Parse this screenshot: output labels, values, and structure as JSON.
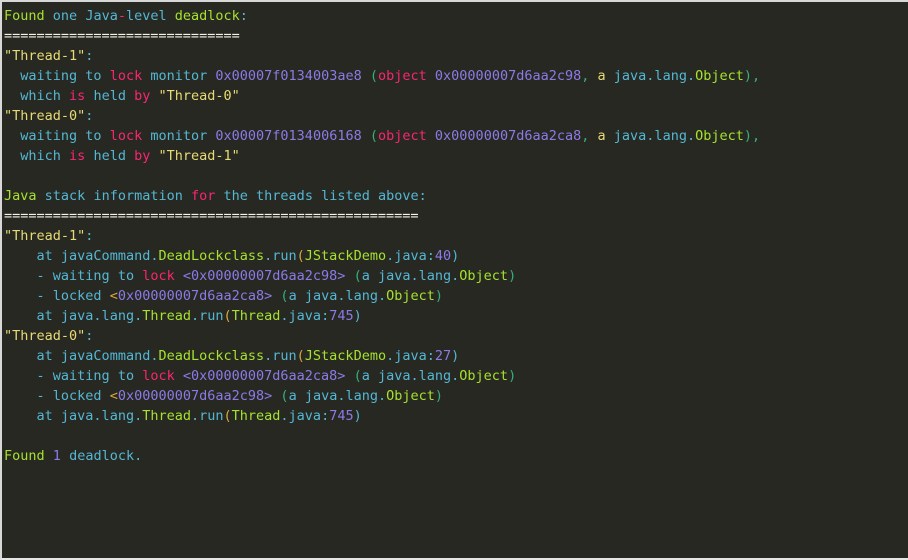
{
  "window": {
    "title": "jstack deadlock output",
    "background_color": "#272822",
    "border_color": "#d8d8d8"
  },
  "palette": {
    "green": "#a6e22e",
    "cyan": "#54b7d4",
    "red": "#f92672",
    "purple": "#8d7ae6",
    "yellow": "#e6db74",
    "white": "#f6f2e7",
    "orange": "#d8a93c",
    "teal": "#35b07b"
  },
  "console": {
    "lines": [
      {
        "id": "line-found-one-deadlock",
        "tokens": [
          {
            "t": "Found",
            "c": "c-green"
          },
          {
            "t": " ",
            "c": "c-cyan"
          },
          {
            "t": "one",
            "c": "c-cyan"
          },
          {
            "t": " ",
            "c": "c-cyan"
          },
          {
            "t": "Java",
            "c": "c-cyan"
          },
          {
            "t": "-",
            "c": "c-red"
          },
          {
            "t": "level",
            "c": "c-cyan"
          },
          {
            "t": " ",
            "c": "c-cyan"
          },
          {
            "t": "deadlock",
            "c": "c-green"
          },
          {
            "t": ":",
            "c": "c-cyan"
          }
        ]
      },
      {
        "id": "line-separator-1",
        "tokens": [
          {
            "t": "=============================",
            "c": "c-white"
          }
        ]
      },
      {
        "id": "line-thread-1-header",
        "tokens": [
          {
            "t": "\"Thread-1\"",
            "c": "c-yellow"
          },
          {
            "t": ":",
            "c": "c-cyan"
          }
        ]
      },
      {
        "id": "line-thread-1-waiting-monitor",
        "tokens": [
          {
            "t": "  waiting",
            "c": "c-cyan"
          },
          {
            "t": " ",
            "c": "c-cyan"
          },
          {
            "t": "to",
            "c": "c-cyan"
          },
          {
            "t": " ",
            "c": "c-cyan"
          },
          {
            "t": "lock",
            "c": "c-red"
          },
          {
            "t": " ",
            "c": "c-cyan"
          },
          {
            "t": "monitor",
            "c": "c-cyan"
          },
          {
            "t": " ",
            "c": "c-cyan"
          },
          {
            "t": "0x00007f0134003ae8",
            "c": "c-purple"
          },
          {
            "t": " ",
            "c": "c-cyan"
          },
          {
            "t": "(",
            "c": "c-teal"
          },
          {
            "t": "object",
            "c": "c-red"
          },
          {
            "t": " ",
            "c": "c-cyan"
          },
          {
            "t": "0x00000007d6aa2c98",
            "c": "c-purple"
          },
          {
            "t": ",",
            "c": "c-teal"
          },
          {
            "t": " ",
            "c": "c-cyan"
          },
          {
            "t": "a",
            "c": "c-yellow"
          },
          {
            "t": " ",
            "c": "c-cyan"
          },
          {
            "t": "java.lang.",
            "c": "c-cyan"
          },
          {
            "t": "Object",
            "c": "c-green"
          },
          {
            "t": ")",
            "c": "c-teal"
          },
          {
            "t": ",",
            "c": "c-teal"
          }
        ]
      },
      {
        "id": "line-thread-1-which-held-by",
        "tokens": [
          {
            "t": "  which",
            "c": "c-cyan"
          },
          {
            "t": " ",
            "c": "c-cyan"
          },
          {
            "t": "is",
            "c": "c-red"
          },
          {
            "t": " ",
            "c": "c-cyan"
          },
          {
            "t": "held",
            "c": "c-cyan"
          },
          {
            "t": " ",
            "c": "c-cyan"
          },
          {
            "t": "by",
            "c": "c-red"
          },
          {
            "t": " ",
            "c": "c-cyan"
          },
          {
            "t": "\"Thread-0\"",
            "c": "c-yellow"
          }
        ]
      },
      {
        "id": "line-thread-0-header",
        "tokens": [
          {
            "t": "\"Thread-0\"",
            "c": "c-yellow"
          },
          {
            "t": ":",
            "c": "c-cyan"
          }
        ]
      },
      {
        "id": "line-thread-0-waiting-monitor",
        "tokens": [
          {
            "t": "  waiting",
            "c": "c-cyan"
          },
          {
            "t": " ",
            "c": "c-cyan"
          },
          {
            "t": "to",
            "c": "c-cyan"
          },
          {
            "t": " ",
            "c": "c-cyan"
          },
          {
            "t": "lock",
            "c": "c-red"
          },
          {
            "t": " ",
            "c": "c-cyan"
          },
          {
            "t": "monitor",
            "c": "c-cyan"
          },
          {
            "t": " ",
            "c": "c-cyan"
          },
          {
            "t": "0x00007f0134006168",
            "c": "c-purple"
          },
          {
            "t": " ",
            "c": "c-cyan"
          },
          {
            "t": "(",
            "c": "c-teal"
          },
          {
            "t": "object",
            "c": "c-red"
          },
          {
            "t": " ",
            "c": "c-cyan"
          },
          {
            "t": "0x00000007d6aa2ca8",
            "c": "c-purple"
          },
          {
            "t": ",",
            "c": "c-teal"
          },
          {
            "t": " ",
            "c": "c-cyan"
          },
          {
            "t": "a",
            "c": "c-yellow"
          },
          {
            "t": " ",
            "c": "c-cyan"
          },
          {
            "t": "java.lang.",
            "c": "c-cyan"
          },
          {
            "t": "Object",
            "c": "c-green"
          },
          {
            "t": ")",
            "c": "c-teal"
          },
          {
            "t": ",",
            "c": "c-teal"
          }
        ]
      },
      {
        "id": "line-thread-0-which-held-by",
        "tokens": [
          {
            "t": "  which",
            "c": "c-cyan"
          },
          {
            "t": " ",
            "c": "c-cyan"
          },
          {
            "t": "is",
            "c": "c-red"
          },
          {
            "t": " ",
            "c": "c-cyan"
          },
          {
            "t": "held",
            "c": "c-cyan"
          },
          {
            "t": " ",
            "c": "c-cyan"
          },
          {
            "t": "by",
            "c": "c-red"
          },
          {
            "t": " ",
            "c": "c-cyan"
          },
          {
            "t": "\"Thread-1\"",
            "c": "c-yellow"
          }
        ]
      },
      {
        "id": "line-blank-1",
        "tokens": []
      },
      {
        "id": "line-java-stack-information",
        "tokens": [
          {
            "t": "Java",
            "c": "c-green"
          },
          {
            "t": " ",
            "c": "c-cyan"
          },
          {
            "t": "stack",
            "c": "c-cyan"
          },
          {
            "t": " ",
            "c": "c-cyan"
          },
          {
            "t": "information",
            "c": "c-cyan"
          },
          {
            "t": " ",
            "c": "c-cyan"
          },
          {
            "t": "for",
            "c": "c-red"
          },
          {
            "t": " ",
            "c": "c-cyan"
          },
          {
            "t": "the",
            "c": "c-cyan"
          },
          {
            "t": " ",
            "c": "c-cyan"
          },
          {
            "t": "threads",
            "c": "c-cyan"
          },
          {
            "t": " ",
            "c": "c-cyan"
          },
          {
            "t": "listed",
            "c": "c-cyan"
          },
          {
            "t": " ",
            "c": "c-cyan"
          },
          {
            "t": "above",
            "c": "c-cyan"
          },
          {
            "t": ":",
            "c": "c-cyan"
          }
        ]
      },
      {
        "id": "line-separator-2",
        "tokens": [
          {
            "t": "===================================================",
            "c": "c-white"
          }
        ]
      },
      {
        "id": "line-stack-thread-1-header",
        "tokens": [
          {
            "t": "\"Thread-1\"",
            "c": "c-yellow"
          },
          {
            "t": ":",
            "c": "c-cyan"
          }
        ]
      },
      {
        "id": "line-stack-thread-1-frame-1",
        "tokens": [
          {
            "t": "    at",
            "c": "c-cyan"
          },
          {
            "t": " ",
            "c": "c-cyan"
          },
          {
            "t": "javaCommand.",
            "c": "c-cyan"
          },
          {
            "t": "DeadLockclass",
            "c": "c-green"
          },
          {
            "t": ".run",
            "c": "c-cyan"
          },
          {
            "t": "(",
            "c": "c-orange"
          },
          {
            "t": "JStackDemo",
            "c": "c-green"
          },
          {
            "t": ".java",
            "c": "c-cyan"
          },
          {
            "t": ":",
            "c": "c-cyan"
          },
          {
            "t": "40",
            "c": "c-purple"
          },
          {
            "t": ")",
            "c": "c-cyan"
          }
        ]
      },
      {
        "id": "line-stack-thread-1-waiting-lock",
        "tokens": [
          {
            "t": "    - waiting",
            "c": "c-cyan"
          },
          {
            "t": " ",
            "c": "c-cyan"
          },
          {
            "t": "to",
            "c": "c-cyan"
          },
          {
            "t": " ",
            "c": "c-cyan"
          },
          {
            "t": "lock",
            "c": "c-red"
          },
          {
            "t": " ",
            "c": "c-cyan"
          },
          {
            "t": "<0x00000007d6aa2c98>",
            "c": "c-purple"
          },
          {
            "t": " ",
            "c": "c-cyan"
          },
          {
            "t": "(",
            "c": "c-teal"
          },
          {
            "t": "a",
            "c": "c-cyan"
          },
          {
            "t": " ",
            "c": "c-cyan"
          },
          {
            "t": "java.lang.",
            "c": "c-cyan"
          },
          {
            "t": "Object",
            "c": "c-green"
          },
          {
            "t": ")",
            "c": "c-teal"
          }
        ]
      },
      {
        "id": "line-stack-thread-1-locked",
        "tokens": [
          {
            "t": "    - locked",
            "c": "c-cyan"
          },
          {
            "t": " ",
            "c": "c-cyan"
          },
          {
            "t": "<",
            "c": "c-orange"
          },
          {
            "t": "0x00000007d6aa2ca8",
            "c": "c-purple"
          },
          {
            "t": ">",
            "c": "c-purple"
          },
          {
            "t": " ",
            "c": "c-cyan"
          },
          {
            "t": "(",
            "c": "c-teal"
          },
          {
            "t": "a",
            "c": "c-cyan"
          },
          {
            "t": " ",
            "c": "c-cyan"
          },
          {
            "t": "java.lang.",
            "c": "c-cyan"
          },
          {
            "t": "Object",
            "c": "c-green"
          },
          {
            "t": ")",
            "c": "c-teal"
          }
        ]
      },
      {
        "id": "line-stack-thread-1-frame-2",
        "tokens": [
          {
            "t": "    at",
            "c": "c-cyan"
          },
          {
            "t": " ",
            "c": "c-cyan"
          },
          {
            "t": "java.lang.",
            "c": "c-cyan"
          },
          {
            "t": "Thread",
            "c": "c-green"
          },
          {
            "t": ".run",
            "c": "c-cyan"
          },
          {
            "t": "(",
            "c": "c-orange"
          },
          {
            "t": "Thread",
            "c": "c-green"
          },
          {
            "t": ".java",
            "c": "c-cyan"
          },
          {
            "t": ":",
            "c": "c-cyan"
          },
          {
            "t": "745",
            "c": "c-purple"
          },
          {
            "t": ")",
            "c": "c-cyan"
          }
        ]
      },
      {
        "id": "line-stack-thread-0-header",
        "tokens": [
          {
            "t": "\"Thread-0\"",
            "c": "c-yellow"
          },
          {
            "t": ":",
            "c": "c-cyan"
          }
        ]
      },
      {
        "id": "line-stack-thread-0-frame-1",
        "tokens": [
          {
            "t": "    at",
            "c": "c-cyan"
          },
          {
            "t": " ",
            "c": "c-cyan"
          },
          {
            "t": "javaCommand.",
            "c": "c-cyan"
          },
          {
            "t": "DeadLockclass",
            "c": "c-green"
          },
          {
            "t": ".run",
            "c": "c-cyan"
          },
          {
            "t": "(",
            "c": "c-orange"
          },
          {
            "t": "JStackDemo",
            "c": "c-green"
          },
          {
            "t": ".java",
            "c": "c-cyan"
          },
          {
            "t": ":",
            "c": "c-cyan"
          },
          {
            "t": "27",
            "c": "c-purple"
          },
          {
            "t": ")",
            "c": "c-cyan"
          }
        ]
      },
      {
        "id": "line-stack-thread-0-waiting-lock",
        "tokens": [
          {
            "t": "    - waiting",
            "c": "c-cyan"
          },
          {
            "t": " ",
            "c": "c-cyan"
          },
          {
            "t": "to",
            "c": "c-cyan"
          },
          {
            "t": " ",
            "c": "c-cyan"
          },
          {
            "t": "lock",
            "c": "c-red"
          },
          {
            "t": " ",
            "c": "c-cyan"
          },
          {
            "t": "<0x00000007d6aa2ca8>",
            "c": "c-purple"
          },
          {
            "t": " ",
            "c": "c-cyan"
          },
          {
            "t": "(",
            "c": "c-teal"
          },
          {
            "t": "a",
            "c": "c-cyan"
          },
          {
            "t": " ",
            "c": "c-cyan"
          },
          {
            "t": "java.lang.",
            "c": "c-cyan"
          },
          {
            "t": "Object",
            "c": "c-green"
          },
          {
            "t": ")",
            "c": "c-teal"
          }
        ]
      },
      {
        "id": "line-stack-thread-0-locked",
        "tokens": [
          {
            "t": "    - locked",
            "c": "c-cyan"
          },
          {
            "t": " ",
            "c": "c-cyan"
          },
          {
            "t": "<",
            "c": "c-orange"
          },
          {
            "t": "0x00000007d6aa2c98",
            "c": "c-purple"
          },
          {
            "t": ">",
            "c": "c-purple"
          },
          {
            "t": " ",
            "c": "c-cyan"
          },
          {
            "t": "(",
            "c": "c-teal"
          },
          {
            "t": "a",
            "c": "c-cyan"
          },
          {
            "t": " ",
            "c": "c-cyan"
          },
          {
            "t": "java.lang.",
            "c": "c-cyan"
          },
          {
            "t": "Object",
            "c": "c-green"
          },
          {
            "t": ")",
            "c": "c-teal"
          }
        ]
      },
      {
        "id": "line-stack-thread-0-frame-2",
        "tokens": [
          {
            "t": "    at",
            "c": "c-cyan"
          },
          {
            "t": " ",
            "c": "c-cyan"
          },
          {
            "t": "java.lang.",
            "c": "c-cyan"
          },
          {
            "t": "Thread",
            "c": "c-green"
          },
          {
            "t": ".run",
            "c": "c-cyan"
          },
          {
            "t": "(",
            "c": "c-orange"
          },
          {
            "t": "Thread",
            "c": "c-green"
          },
          {
            "t": ".java",
            "c": "c-cyan"
          },
          {
            "t": ":",
            "c": "c-cyan"
          },
          {
            "t": "745",
            "c": "c-purple"
          },
          {
            "t": ")",
            "c": "c-cyan"
          }
        ]
      },
      {
        "id": "line-blank-2",
        "tokens": []
      },
      {
        "id": "line-found-1-deadlock",
        "tokens": [
          {
            "t": "Found",
            "c": "c-green"
          },
          {
            "t": " ",
            "c": "c-cyan"
          },
          {
            "t": "1",
            "c": "c-purple"
          },
          {
            "t": " ",
            "c": "c-cyan"
          },
          {
            "t": "deadlock",
            "c": "c-cyan"
          },
          {
            "t": ".",
            "c": "c-cyan"
          }
        ]
      }
    ]
  }
}
